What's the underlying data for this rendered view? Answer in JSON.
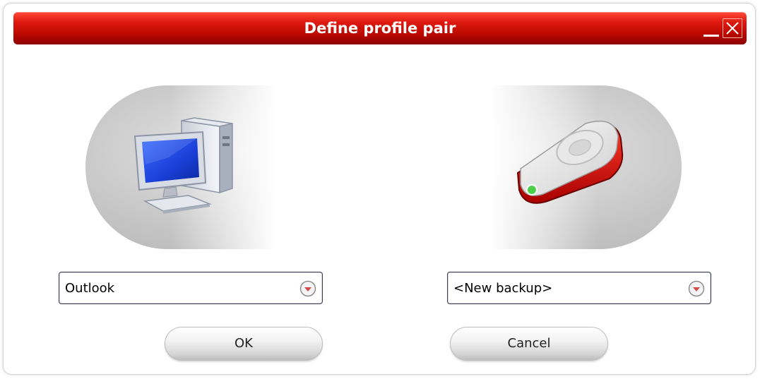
{
  "window": {
    "title": "Define profile pair",
    "accent_color": "#cc1100"
  },
  "titlebar": {
    "minimize_icon": "minimize-icon",
    "close_icon": "close-icon"
  },
  "source": {
    "icon": "desktop-computer-icon",
    "selected": "Outlook"
  },
  "target": {
    "icon": "external-drive-icon",
    "selected": "<New backup>"
  },
  "buttons": {
    "ok_label": "OK",
    "cancel_label": "Cancel"
  }
}
